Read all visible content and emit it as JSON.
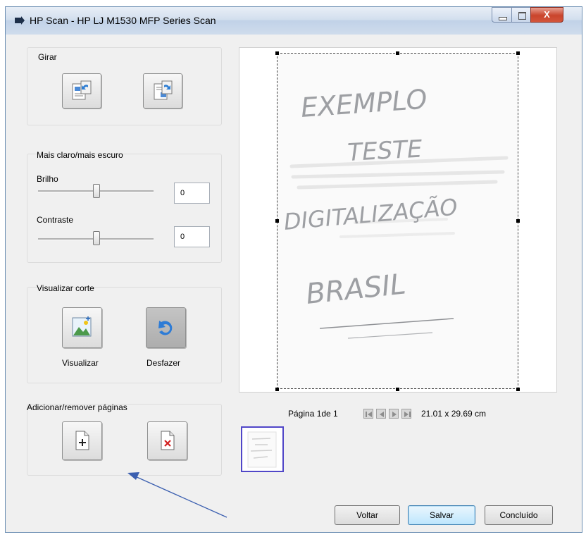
{
  "window": {
    "title": "HP Scan - HP LJ M1530 MFP Series Scan",
    "app_icon": "arrow-icon",
    "controls": [
      "minimize",
      "maximize",
      "close"
    ]
  },
  "rotate_group": {
    "label": "Girar",
    "buttons": [
      {
        "name": "rotate-left",
        "icon": "rotate-left-icon"
      },
      {
        "name": "rotate-right",
        "icon": "rotate-right-icon"
      }
    ]
  },
  "adjust_group": {
    "label": "Mais claro/mais escuro",
    "brightness": {
      "label": "Brilho",
      "value": "0",
      "slider_fraction": 0.5
    },
    "contrast": {
      "label": "Contraste",
      "value": "0",
      "slider_fraction": 0.5
    }
  },
  "crop_group": {
    "label": "Visualizar corte",
    "preview_label": "Visualizar",
    "undo_label": "Desfazer"
  },
  "pages_group": {
    "label": "Adicionar/remover páginas",
    "add_icon": "add-page-icon",
    "remove_icon": "remove-page-icon"
  },
  "preview": {
    "handwriting": [
      "EXEMPLO",
      "TESTE",
      "DIGITALIZAÇÃO",
      "BRASIL"
    ]
  },
  "pagination": {
    "page_text": "Página 1de 1",
    "dimensions": "21.01 x 29.69 cm"
  },
  "footer": {
    "back_label": "Voltar",
    "save_label": "Salvar",
    "done_label": "Concluído"
  },
  "colors": {
    "annotation_arrow": "#3b5fb0",
    "thumbnail_border": "#5046c8"
  }
}
